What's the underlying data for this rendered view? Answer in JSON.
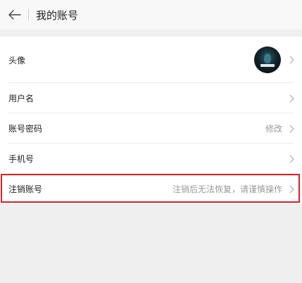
{
  "header": {
    "title": "我的账号",
    "back_icon": "arrow-left-icon"
  },
  "rows": [
    {
      "label": "头像",
      "value": "",
      "has_avatar": true
    },
    {
      "label": "用户名",
      "value": ""
    },
    {
      "label": "账号密码",
      "value": "修改"
    },
    {
      "label": "手机号",
      "value": ""
    },
    {
      "label": "注销账号",
      "value": "注销后无法恢复，请谨慎操作"
    }
  ],
  "colors": {
    "page_background": "#efefef",
    "row_background": "#ffffff",
    "highlight_border": "#d4222a",
    "secondary_text": "#9a9a9a"
  },
  "icons": {
    "chevron": "chevron-right-icon",
    "back": "arrow-left-icon"
  }
}
